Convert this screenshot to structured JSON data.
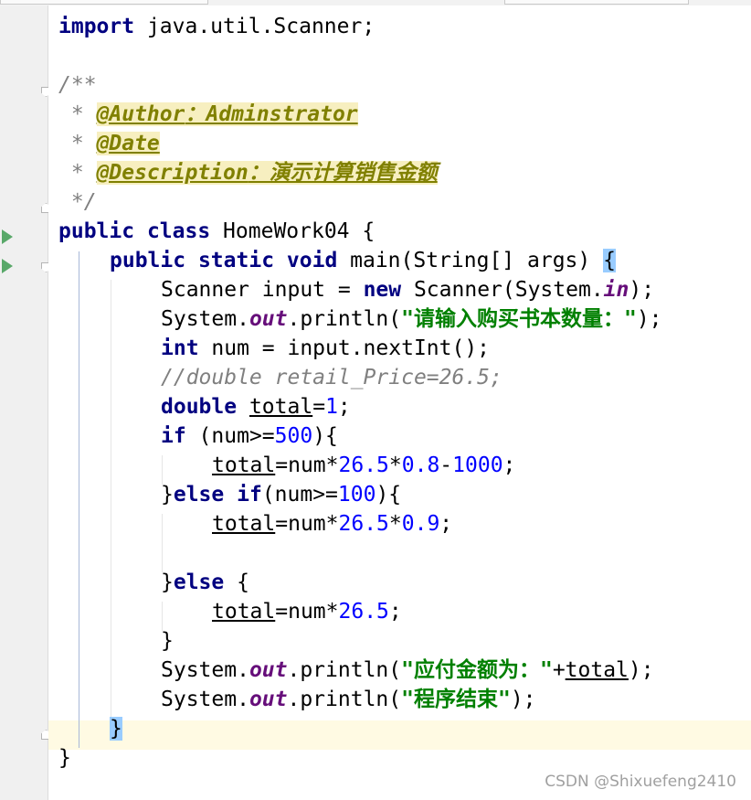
{
  "code": {
    "l1": {
      "kw": "import",
      "rest": " java.util.Scanner;"
    },
    "l3": "/**",
    "l4": {
      "star": " * ",
      "tag": "@Author",
      "text": "：Adminstrator"
    },
    "l5": {
      "star": " * ",
      "tag": "@Date"
    },
    "l6": {
      "star": " * ",
      "tag": "@Description",
      "text": "：演示计算销售金额"
    },
    "l7": " */",
    "l8": {
      "kw1": "public",
      "kw2": "class",
      "rest": " HomeWork04 {"
    },
    "l9": {
      "kw1": "public",
      "kw2": "static",
      "kw3": "void",
      "rest": " main(String[] args) ",
      "brace": "{"
    },
    "l10": {
      "pre": "Scanner input = ",
      "kw": "new",
      "mid": " Scanner(System.",
      "fld": "in",
      "post": ");"
    },
    "l11": {
      "pre": "System.",
      "fld": "out",
      "mid": ".println(",
      "str": "\"请输入购买书本数量：\"",
      "post": ");"
    },
    "l12": {
      "kw": "int",
      "rest": " num = input.nextInt();"
    },
    "l13": "//double retail_Price=26.5;",
    "l14": {
      "kw": "double",
      "var": "total",
      "mid": "=",
      "num": "1",
      "post": ";"
    },
    "l15": {
      "kw": "if",
      "mid": " (num>=",
      "num": "500",
      "post": "){"
    },
    "l16": {
      "var": "total",
      "mid": "=num*",
      "num1": "26.5",
      "op1": "*",
      "num2": "0.8",
      "op2": "-",
      "num3": "1000",
      "post": ";"
    },
    "l17": {
      "pre": "}",
      "kw1": "else",
      "kw2": "if",
      "mid": "(num>=",
      "num": "100",
      "post": "){"
    },
    "l18": {
      "var": "total",
      "mid": "=num*",
      "num1": "26.5",
      "op1": "*",
      "num2": "0.9",
      "post": ";"
    },
    "l20": {
      "pre": "}",
      "kw": "else",
      "post": " {"
    },
    "l21": {
      "var": "total",
      "mid": "=num*",
      "num": "26.5",
      "post": ";"
    },
    "l22": "}",
    "l23": {
      "pre": "System.",
      "fld": "out",
      "mid": ".println(",
      "str": "\"应付金额为：\"",
      "plus": "+",
      "var": "total",
      "post": ");"
    },
    "l24": {
      "pre": "System.",
      "fld": "out",
      "mid": ".println(",
      "str": "\"程序结束\"",
      "post": ");"
    },
    "l25": "}",
    "l26": "}"
  },
  "watermark": "CSDN @Shixuefeng2410",
  "colors": {
    "keyword": "#000080",
    "string": "#008000",
    "number": "#0000ff",
    "field": "#660e7a",
    "comment": "#808080",
    "annotation": "#808000",
    "current_line": "#fffae3",
    "gutter": "#f0f0f0"
  }
}
